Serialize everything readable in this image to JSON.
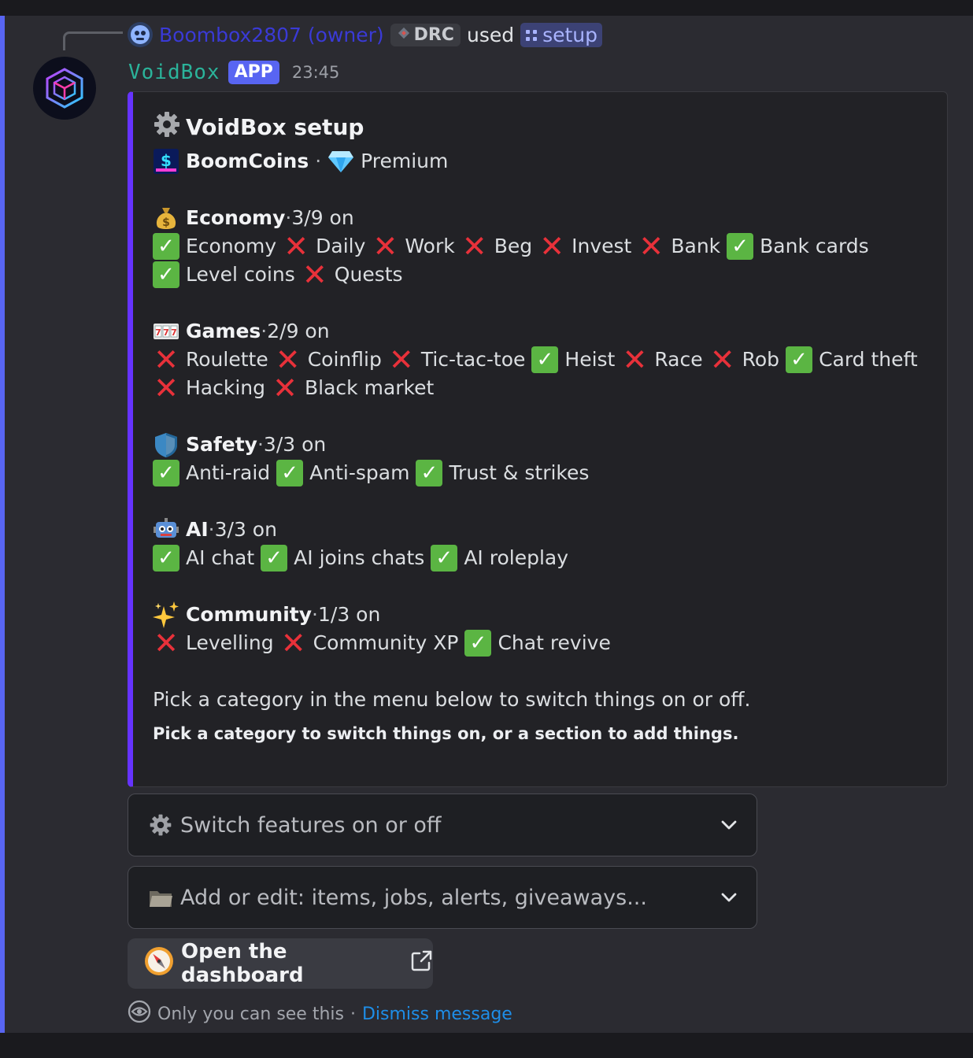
{
  "reply": {
    "user": "Boombox2807 (owner)",
    "server_tag": "DRC",
    "action": "used",
    "command": "setup"
  },
  "message": {
    "bot_name": "VoidBox",
    "badge": "APP",
    "time": "23:45"
  },
  "embed": {
    "title": "VoidBox setup",
    "currency_name": "BoomCoins",
    "sep": "·",
    "tier": "Premium",
    "sections": [
      {
        "icon": "money-bag-icon",
        "name": "Economy",
        "status": "3/9 on",
        "items": [
          {
            "label": "Economy",
            "on": true
          },
          {
            "label": "Daily",
            "on": false
          },
          {
            "label": "Work",
            "on": false
          },
          {
            "label": "Beg",
            "on": false
          },
          {
            "label": "Invest",
            "on": false
          },
          {
            "label": "Bank",
            "on": false
          },
          {
            "label": "Bank cards",
            "on": true
          },
          {
            "label": "Level coins",
            "on": true
          },
          {
            "label": "Quests",
            "on": false
          }
        ]
      },
      {
        "icon": "slot-machine-icon",
        "name": "Games",
        "status": "2/9 on",
        "items": [
          {
            "label": "Roulette",
            "on": false
          },
          {
            "label": "Coinflip",
            "on": false
          },
          {
            "label": "Tic-tac-toe",
            "on": false
          },
          {
            "label": "Heist",
            "on": true
          },
          {
            "label": "Race",
            "on": false
          },
          {
            "label": "Rob",
            "on": false
          },
          {
            "label": "Card theft",
            "on": true
          },
          {
            "label": "Hacking",
            "on": false
          },
          {
            "label": "Black market",
            "on": false
          }
        ]
      },
      {
        "icon": "shield-icon",
        "name": "Safety",
        "status": "3/3 on",
        "items": [
          {
            "label": "Anti-raid",
            "on": true
          },
          {
            "label": "Anti-spam",
            "on": true
          },
          {
            "label": "Trust & strikes",
            "on": true
          }
        ]
      },
      {
        "icon": "robot-icon",
        "name": "AI",
        "status": "3/3 on",
        "items": [
          {
            "label": "AI chat",
            "on": true
          },
          {
            "label": "AI joins chats",
            "on": true
          },
          {
            "label": "AI roleplay",
            "on": true
          }
        ]
      },
      {
        "icon": "sparkles-icon",
        "name": "Community",
        "status": "1/3 on",
        "items": [
          {
            "label": "Levelling",
            "on": false
          },
          {
            "label": "Community XP",
            "on": false
          },
          {
            "label": "Chat revive",
            "on": true
          }
        ]
      }
    ],
    "instruction": "Pick a category in the menu below to switch things on or off.",
    "footer": "Pick a category to switch things on, or a section to add things."
  },
  "components": {
    "select_features": "Switch features on or off",
    "select_add": "Add or edit: items, jobs, alerts, giveaways...",
    "dashboard_button": "Open the dashboard"
  },
  "ephemeral": {
    "notice": "Only you can see this",
    "sep": "·",
    "dismiss": "Dismiss message"
  },
  "colors": {
    "accent": "#5865f2",
    "embed_bar": "#6633ff",
    "bot_name": "#2bb39a",
    "check": "#5bb543",
    "cross": "#e8313a",
    "link": "#1e8ee8"
  }
}
